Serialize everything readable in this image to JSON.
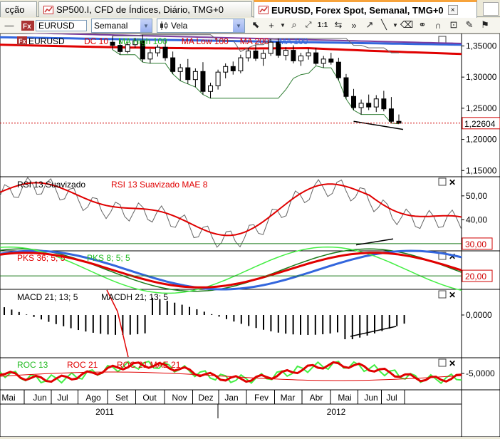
{
  "tabs": [
    {
      "label": "cção",
      "active": false
    },
    {
      "label": "SP500.I, CFD de Índices, Diário, TMG+0",
      "active": false
    },
    {
      "label": "EURUSD, Forex Spot, Semanal, TMG+0",
      "active": true
    }
  ],
  "tab_close_glyph": "×",
  "toolbar": {
    "symbol": "EURUSD",
    "timeframe": "Semanal",
    "chart_style": "Vela"
  },
  "chart_data": {
    "type": "candlestick",
    "symbol_label": "EURUSD",
    "price_panel": {
      "legend": [
        {
          "label": "DC 10",
          "color": "#e00000"
        },
        {
          "label": "MA High 100",
          "color": "#22bb22"
        },
        {
          "label": "MA Low 100",
          "color": "#e00000"
        },
        {
          "label": "MA 200",
          "color": "#e00000"
        },
        {
          "label": "MA 100",
          "color": "#3366dd"
        }
      ],
      "y_ticks": [
        "1,35000",
        "1,30000",
        "1,25000",
        "1,20000",
        "1,15000"
      ],
      "current_price": "1,22604",
      "ylim": [
        1.14,
        1.37
      ],
      "candles": [
        [
          1.356,
          1.366,
          1.344,
          1.351
        ],
        [
          1.351,
          1.362,
          1.336,
          1.341
        ],
        [
          1.341,
          1.356,
          1.338,
          1.352
        ],
        [
          1.352,
          1.363,
          1.347,
          1.358
        ],
        [
          1.358,
          1.368,
          1.324,
          1.329
        ],
        [
          1.329,
          1.345,
          1.322,
          1.339
        ],
        [
          1.339,
          1.352,
          1.333,
          1.348
        ],
        [
          1.348,
          1.359,
          1.326,
          1.331
        ],
        [
          1.331,
          1.341,
          1.305,
          1.309
        ],
        [
          1.309,
          1.321,
          1.294,
          1.315
        ],
        [
          1.315,
          1.329,
          1.289,
          1.296
        ],
        [
          1.296,
          1.314,
          1.284,
          1.309
        ],
        [
          1.309,
          1.324,
          1.272,
          1.277
        ],
        [
          1.277,
          1.291,
          1.266,
          1.286
        ],
        [
          1.286,
          1.312,
          1.28,
          1.308
        ],
        [
          1.308,
          1.322,
          1.298,
          1.317
        ],
        [
          1.317,
          1.325,
          1.304,
          1.31
        ],
        [
          1.31,
          1.336,
          1.306,
          1.331
        ],
        [
          1.331,
          1.347,
          1.325,
          1.342
        ],
        [
          1.342,
          1.352,
          1.326,
          1.33
        ],
        [
          1.33,
          1.344,
          1.318,
          1.338
        ],
        [
          1.338,
          1.361,
          1.334,
          1.356
        ],
        [
          1.356,
          1.362,
          1.331,
          1.335
        ],
        [
          1.335,
          1.348,
          1.327,
          1.343
        ],
        [
          1.343,
          1.351,
          1.322,
          1.326
        ],
        [
          1.326,
          1.339,
          1.318,
          1.334
        ],
        [
          1.334,
          1.346,
          1.328,
          1.339
        ],
        [
          1.339,
          1.347,
          1.319,
          1.322
        ],
        [
          1.322,
          1.334,
          1.315,
          1.329
        ],
        [
          1.329,
          1.339,
          1.32,
          1.324
        ],
        [
          1.324,
          1.331,
          1.295,
          1.299
        ],
        [
          1.299,
          1.305,
          1.265,
          1.269
        ],
        [
          1.269,
          1.281,
          1.247,
          1.251
        ],
        [
          1.251,
          1.264,
          1.24,
          1.258
        ],
        [
          1.258,
          1.272,
          1.247,
          1.252
        ],
        [
          1.252,
          1.271,
          1.244,
          1.265
        ],
        [
          1.265,
          1.278,
          1.245,
          1.249
        ],
        [
          1.249,
          1.268,
          1.226,
          1.229
        ],
        [
          1.229,
          1.24,
          1.225,
          1.226
        ]
      ]
    },
    "rsi_panel": {
      "legend": [
        "RSI 13 Suavizado",
        "RSI 13 Suavizado MAE 8"
      ],
      "y_ticks": [
        "50,00",
        "40,00"
      ],
      "level": "30,00"
    },
    "pks_panel": {
      "legend": [
        "PKS 36; 5; 5",
        "PKS 8; 5; 5"
      ],
      "level": "20,00"
    },
    "macd_panel": {
      "legend": [
        "MACD 21; 13; 5",
        "MACDH 21; 13; 5"
      ],
      "y_ticks": [
        "0,0000"
      ]
    },
    "roc_panel": {
      "legend": [
        "ROC 13",
        "ROC 21",
        "ROC 21 MAE 21"
      ],
      "y_ticks": [
        "-5,0000"
      ]
    },
    "x_months": [
      "Mai",
      "Jun",
      "Jul",
      "Ago",
      "Set",
      "Out",
      "Nov",
      "Dez",
      "Jan",
      "Fev",
      "Mar",
      "Abr",
      "Mai",
      "Jun",
      "Jul"
    ],
    "x_years": [
      "2011",
      "2012"
    ]
  }
}
